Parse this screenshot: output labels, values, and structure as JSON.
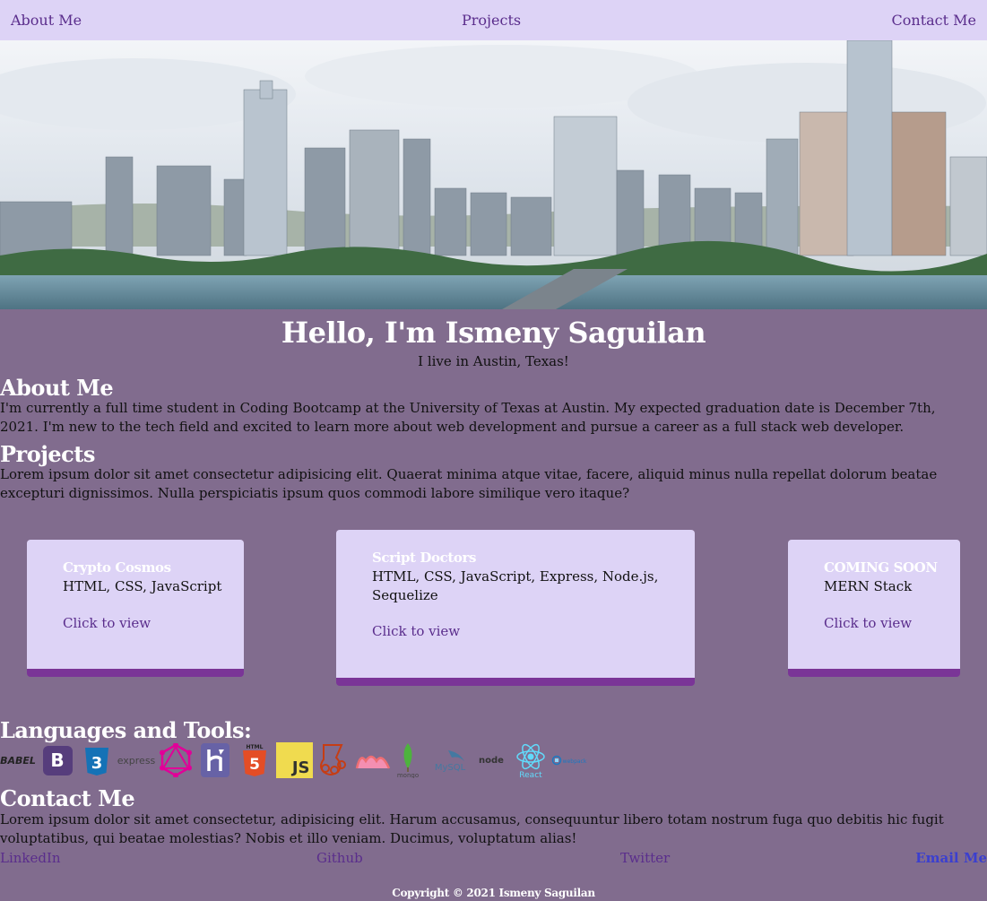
{
  "nav": {
    "about": "About Me",
    "projects": "Projects",
    "contact": "Contact Me"
  },
  "hero": {
    "greeting": "Hello, I'm Ismeny Saguilan",
    "location": "I live in Austin, Texas!"
  },
  "about": {
    "heading": "About Me",
    "text": "I'm currently a full time student in Coding Bootcamp at the University of Texas at Austin. My expected graduation date is December 7th, 2021. I'm new to the tech field and excited to learn more about web development and pursue a career as a full stack web developer."
  },
  "projects": {
    "heading": "Projects",
    "text": "Lorem ipsum dolor sit amet consectetur adipisicing elit. Quaerat minima atque vitae, facere, aliquid minus nulla repellat dolorum beatae excepturi dignissimos. Nulla perspiciatis ipsum quos commodi labore similique vero itaque?",
    "cards": [
      {
        "title": "Crypto Cosmos",
        "stack": "HTML, CSS, JavaScript",
        "link": "Click to view"
      },
      {
        "title": "Script Doctors",
        "stack": "HTML, CSS, JavaScript, Express, Node.js, Sequelize",
        "link": "Click to view"
      },
      {
        "title": "COMING SOON",
        "stack": "MERN Stack",
        "link": "Click to view"
      }
    ]
  },
  "tools": {
    "heading": "Languages and Tools:",
    "items": [
      {
        "icon": "babel-icon",
        "label": "BABEL"
      },
      {
        "icon": "bootstrap-icon",
        "label": "B"
      },
      {
        "icon": "css3-icon",
        "label": "3"
      },
      {
        "icon": "express-icon",
        "label": "express"
      },
      {
        "icon": "graphql-icon",
        "label": ""
      },
      {
        "icon": "heroku-icon",
        "label": ""
      },
      {
        "icon": "html5-icon",
        "label": "5"
      },
      {
        "icon": "javascript-icon",
        "label": "JS"
      },
      {
        "icon": "jest-icon",
        "label": ""
      },
      {
        "icon": "materialize-icon",
        "label": ""
      },
      {
        "icon": "mongodb-icon",
        "label": "mongo"
      },
      {
        "icon": "mysql-icon",
        "label": "MySQL"
      },
      {
        "icon": "nodejs-icon",
        "label": "node"
      },
      {
        "icon": "react-icon",
        "label": "React"
      },
      {
        "icon": "webpack-icon",
        "label": "webpack"
      }
    ]
  },
  "contact": {
    "heading": "Contact Me",
    "text": "Lorem ipsum dolor sit amet consectetur, adipisicing elit. Harum accusamus, consequuntur libero totam nostrum fuga quo debitis hic fugit voluptatibus, qui beatae molestias? Nobis et illo veniam. Ducimus, voluptatum alias!",
    "links": {
      "linkedin": "LinkedIn",
      "github": "Github",
      "twitter": "Twitter",
      "email": "Email Me"
    }
  },
  "footer": {
    "copyright": "Copyright © 2021 Ismeny Saguilan"
  },
  "colors": {
    "page_bg": "#816c8e",
    "nav_bg": "#ddd3f6",
    "card_accent": "#7a3597",
    "link": "#5a2d8c"
  }
}
